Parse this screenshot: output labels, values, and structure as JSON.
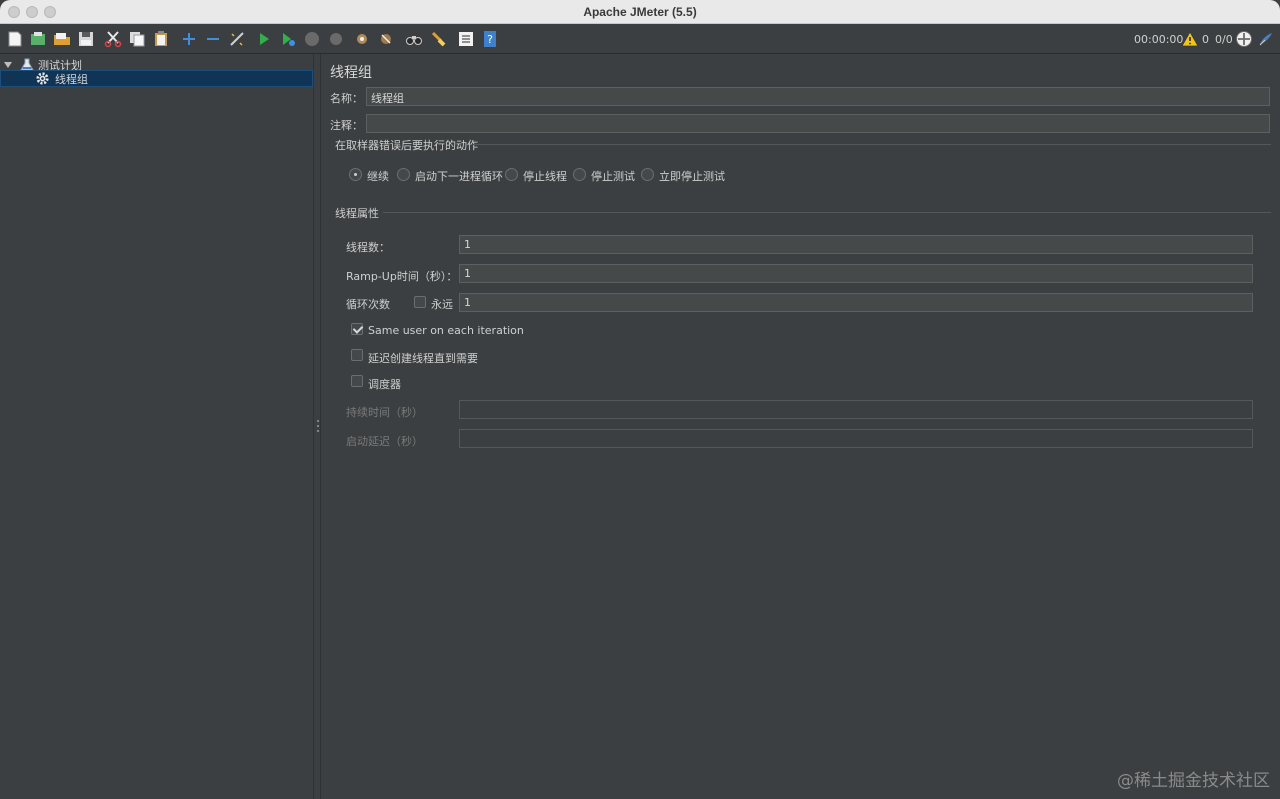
{
  "window": {
    "title": "Apache JMeter (5.5)"
  },
  "toolbar": {
    "buttons": [
      "new",
      "templates",
      "open",
      "save",
      "cut",
      "copy",
      "paste",
      "expand",
      "collapse",
      "toggle",
      "start",
      "start-no-pauses",
      "stop",
      "shutdown",
      "clear",
      "clear-all",
      "search",
      "reset-search",
      "function-helper",
      "help"
    ],
    "elapsed_time": "00:00:00",
    "warning_count": "0",
    "active_threads": "0/0"
  },
  "tree": {
    "items": [
      {
        "label": "测试计划",
        "icon": "flask-icon",
        "expanded": true,
        "level": 0
      },
      {
        "label": "线程组",
        "icon": "gear-icon",
        "selected": true,
        "level": 1
      }
    ]
  },
  "main": {
    "title": "线程组",
    "name_label": "名称：",
    "name_value": "线程组",
    "comment_label": "注释：",
    "comment_value": "",
    "error_action": {
      "group_label": "在取样器错误后要执行的动作",
      "options": [
        "继续",
        "启动下一进程循环",
        "停止线程",
        "停止测试",
        "立即停止测试"
      ],
      "selected": "继续"
    },
    "thread_props": {
      "group_label": "线程属性",
      "num_threads_label": "线程数：",
      "num_threads_value": "1",
      "ramp_up_label": "Ramp-Up时间（秒）：",
      "ramp_up_value": "1",
      "loop_label": "循环次数",
      "forever_label": "永远",
      "forever_checked": false,
      "loop_value": "1",
      "same_user_label": "Same user on each iteration",
      "same_user_checked": true,
      "delay_create_label": "延迟创建线程直到需要",
      "delay_create_checked": false,
      "scheduler_label": "调度器",
      "scheduler_checked": false,
      "duration_label": "持续时间（秒）",
      "duration_value": "",
      "startup_delay_label": "启动延迟（秒）",
      "startup_delay_value": ""
    }
  },
  "watermark": "@稀土掘金技术社区"
}
